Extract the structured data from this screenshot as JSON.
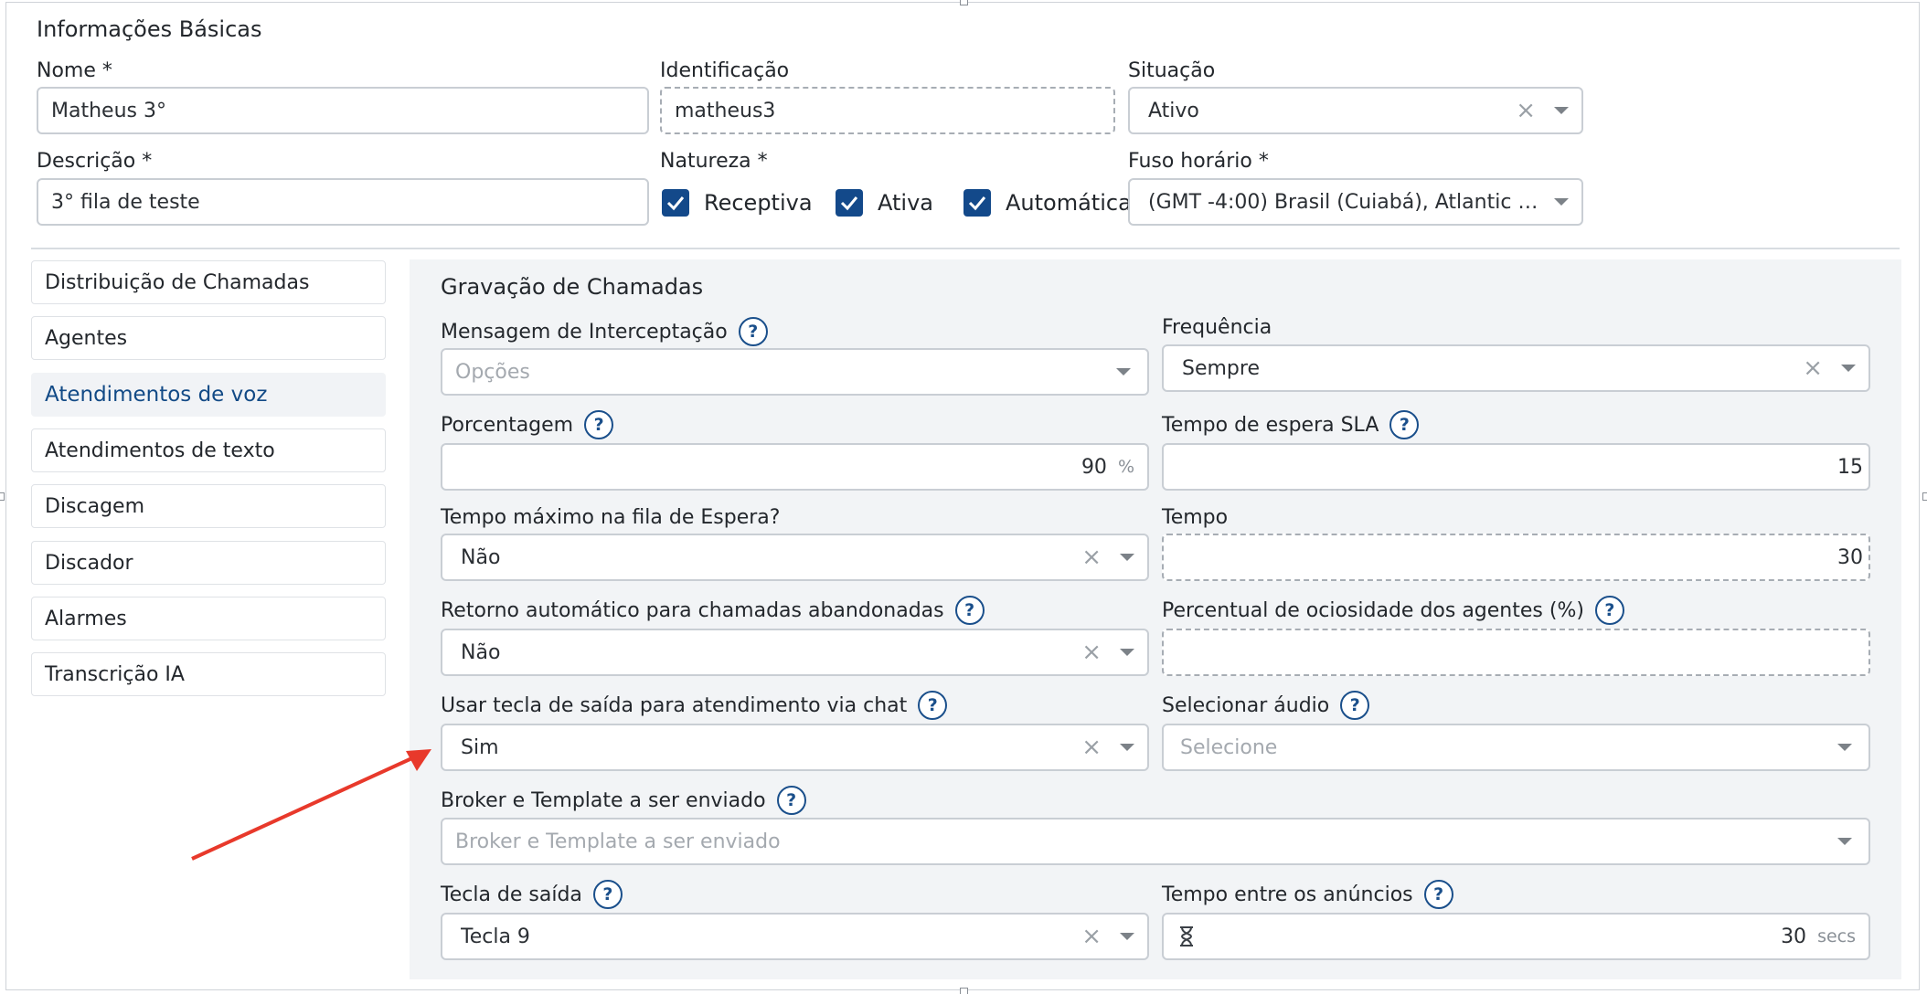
{
  "header": {
    "title": "Informações Básicas",
    "nome": {
      "label": "Nome *",
      "value": "Matheus 3°"
    },
    "identificacao": {
      "label": "Identificação",
      "value": "matheus3"
    },
    "situacao": {
      "label": "Situação",
      "value": "Ativo"
    },
    "descricao": {
      "label": "Descrição *",
      "value": "3° fila de teste"
    },
    "natureza": {
      "label": "Natureza *",
      "options": [
        {
          "label": "Receptiva",
          "checked": true
        },
        {
          "label": "Ativa",
          "checked": true
        },
        {
          "label": "Automática",
          "checked": true
        }
      ]
    },
    "fuso": {
      "label": "Fuso horário *",
      "value": "(GMT -4:00) Brasil (Cuiabá), Atlantic Ti..."
    }
  },
  "sidebar": {
    "items": [
      {
        "label": "Distribuição de Chamadas",
        "active": false
      },
      {
        "label": "Agentes",
        "active": false
      },
      {
        "label": "Atendimentos de voz",
        "active": true
      },
      {
        "label": "Atendimentos de texto",
        "active": false
      },
      {
        "label": "Discagem",
        "active": false
      },
      {
        "label": "Discador",
        "active": false
      },
      {
        "label": "Alarmes",
        "active": false
      },
      {
        "label": "Transcrição IA",
        "active": false
      }
    ]
  },
  "panel": {
    "title": "Gravação de Chamadas",
    "help_glyph": "?",
    "clear_glyph": "×",
    "mensagem": {
      "label": "Mensagem de Interceptação",
      "placeholder": "Opções"
    },
    "frequencia": {
      "label": "Frequência",
      "value": "Sempre"
    },
    "porcentagem": {
      "label": "Porcentagem",
      "value": "90",
      "unit": "%"
    },
    "tempo_sla": {
      "label": "Tempo de espera SLA",
      "value": "15"
    },
    "tempo_max": {
      "label": "Tempo máximo na fila de Espera?",
      "value": "Não"
    },
    "tempo": {
      "label": "Tempo",
      "value": "30"
    },
    "retorno": {
      "label": "Retorno automático para chamadas abandonadas",
      "value": "Não"
    },
    "percentual": {
      "label": "Percentual de ociosidade dos agentes (%)",
      "value": ""
    },
    "usar_tecla": {
      "label": "Usar tecla de saída para atendimento via chat",
      "value": "Sim"
    },
    "selecionar_audio": {
      "label": "Selecionar áudio",
      "placeholder": "Selecione"
    },
    "broker": {
      "label": "Broker e Template a ser enviado",
      "placeholder": "Broker e Template a ser enviado"
    },
    "tecla_saida": {
      "label": "Tecla de saída",
      "value": "Tecla 9"
    },
    "tempo_anuncios": {
      "label": "Tempo entre os anúncios",
      "value": "30",
      "unit": "secs"
    }
  },
  "colors": {
    "accent": "#13498a",
    "arrow": "#e8392b",
    "panel_bg": "#f2f4f6"
  }
}
